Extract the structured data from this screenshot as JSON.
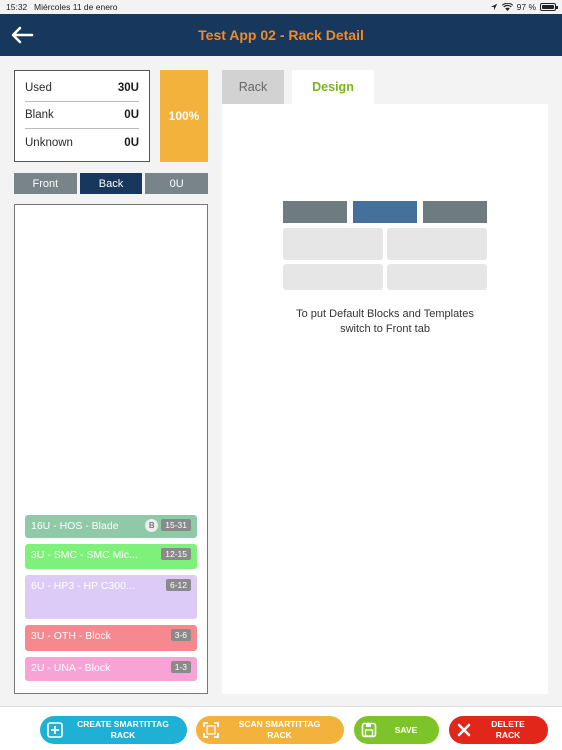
{
  "status": {
    "time": "15:32",
    "date": "Miércoles 11 de enero",
    "battery": "97 %",
    "battery_level": 0.97
  },
  "header": {
    "title": "Test App 02 - Rack Detail"
  },
  "usage": {
    "rows": [
      {
        "label": "Used",
        "value": "30U"
      },
      {
        "label": "Blank",
        "value": "0U"
      },
      {
        "label": "Unknown",
        "value": "0U"
      }
    ],
    "percent": "100%"
  },
  "views": {
    "front": "Front",
    "back": "Back",
    "zero_u": "0U",
    "active": "Back"
  },
  "slots": [
    {
      "label": "16U - HOS - Blade",
      "badge": "B",
      "range": "15-31",
      "color": "#8fc9a8"
    },
    {
      "label": "3U - SMC - SMC Mic...",
      "range": "12-15",
      "color": "#7ef17b"
    },
    {
      "label": "6U - HP3 - HP C300...",
      "range": "6-12",
      "color": "#dccbf7"
    },
    {
      "label": "3U - OTH - Block",
      "range": "3-6",
      "color": "#f6898f"
    },
    {
      "label": "2U - UNA - Block",
      "range": "1-3",
      "color": "#f7a3d6"
    }
  ],
  "tabs": {
    "rack": "Rack",
    "design": "Design",
    "active": "Design"
  },
  "design": {
    "hint_line1": "To put Default Blocks and Templates",
    "hint_line2": "switch to Front tab"
  },
  "actions": {
    "create": {
      "line1": "CREATE SMARTITTAG",
      "line2": "RACK",
      "color": "#1fb0d6"
    },
    "scan": {
      "line1": "SCAN SMARTITTAG",
      "line2": "RACK",
      "color": "#f3b23c"
    },
    "save": {
      "line1": "SAVE",
      "color": "#7cc42a"
    },
    "delete": {
      "line1": "DELETE",
      "line2": "RACK",
      "color": "#e2261a"
    }
  }
}
